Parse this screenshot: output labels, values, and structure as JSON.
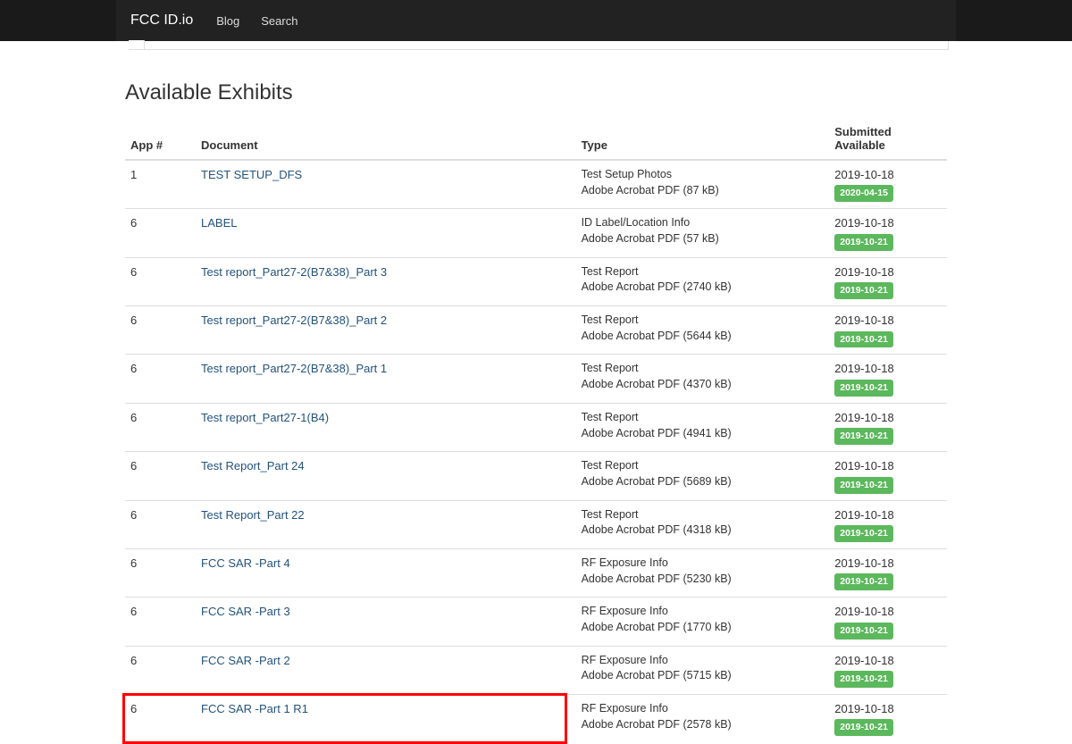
{
  "nav": {
    "brand": "FCC ID.io",
    "links": [
      "Blog",
      "Search"
    ]
  },
  "section_title": "Available Exhibits",
  "table": {
    "headers": {
      "app": "App #",
      "document": "Document",
      "type": "Type",
      "submitted": "Submitted Available"
    },
    "rows": [
      {
        "app": "1",
        "doc": "TEST SETUP_DFS",
        "type": "Test Setup Photos",
        "format": "Adobe Acrobat PDF (87 kB)",
        "submitted": "2019-10-18",
        "available": "2020-04-15",
        "highlight": false
      },
      {
        "app": "6",
        "doc": "LABEL",
        "type": "ID Label/Location Info",
        "format": "Adobe Acrobat PDF (57 kB)",
        "submitted": "2019-10-18",
        "available": "2019-10-21",
        "highlight": false
      },
      {
        "app": "6",
        "doc": "Test report_Part27-2(B7&38)_Part 3",
        "type": "Test Report",
        "format": "Adobe Acrobat PDF (2740 kB)",
        "submitted": "2019-10-18",
        "available": "2019-10-21",
        "highlight": false
      },
      {
        "app": "6",
        "doc": "Test report_Part27-2(B7&38)_Part 2",
        "type": "Test Report",
        "format": "Adobe Acrobat PDF (5644 kB)",
        "submitted": "2019-10-18",
        "available": "2019-10-21",
        "highlight": false
      },
      {
        "app": "6",
        "doc": "Test report_Part27-2(B7&38)_Part 1",
        "type": "Test Report",
        "format": "Adobe Acrobat PDF (4370 kB)",
        "submitted": "2019-10-18",
        "available": "2019-10-21",
        "highlight": false
      },
      {
        "app": "6",
        "doc": "Test report_Part27-1(B4)",
        "type": "Test Report",
        "format": "Adobe Acrobat PDF (4941 kB)",
        "submitted": "2019-10-18",
        "available": "2019-10-21",
        "highlight": false
      },
      {
        "app": "6",
        "doc": "Test Report_Part 24",
        "type": "Test Report",
        "format": "Adobe Acrobat PDF (5689 kB)",
        "submitted": "2019-10-18",
        "available": "2019-10-21",
        "highlight": false
      },
      {
        "app": "6",
        "doc": "Test Report_Part 22",
        "type": "Test Report",
        "format": "Adobe Acrobat PDF (4318 kB)",
        "submitted": "2019-10-18",
        "available": "2019-10-21",
        "highlight": false
      },
      {
        "app": "6",
        "doc": "FCC SAR -Part 4",
        "type": "RF Exposure Info",
        "format": "Adobe Acrobat PDF (5230 kB)",
        "submitted": "2019-10-18",
        "available": "2019-10-21",
        "highlight": false
      },
      {
        "app": "6",
        "doc": "FCC SAR -Part 3",
        "type": "RF Exposure Info",
        "format": "Adobe Acrobat PDF (1770 kB)",
        "submitted": "2019-10-18",
        "available": "2019-10-21",
        "highlight": false
      },
      {
        "app": "6",
        "doc": "FCC SAR -Part 2",
        "type": "RF Exposure Info",
        "format": "Adobe Acrobat PDF (5715 kB)",
        "submitted": "2019-10-18",
        "available": "2019-10-21",
        "highlight": false
      },
      {
        "app": "6",
        "doc": "FCC SAR -Part 1 R1",
        "type": "RF Exposure Info",
        "format": "Adobe Acrobat PDF (2578 kB)",
        "submitted": "2019-10-18",
        "available": "2019-10-21",
        "highlight": true
      }
    ]
  }
}
